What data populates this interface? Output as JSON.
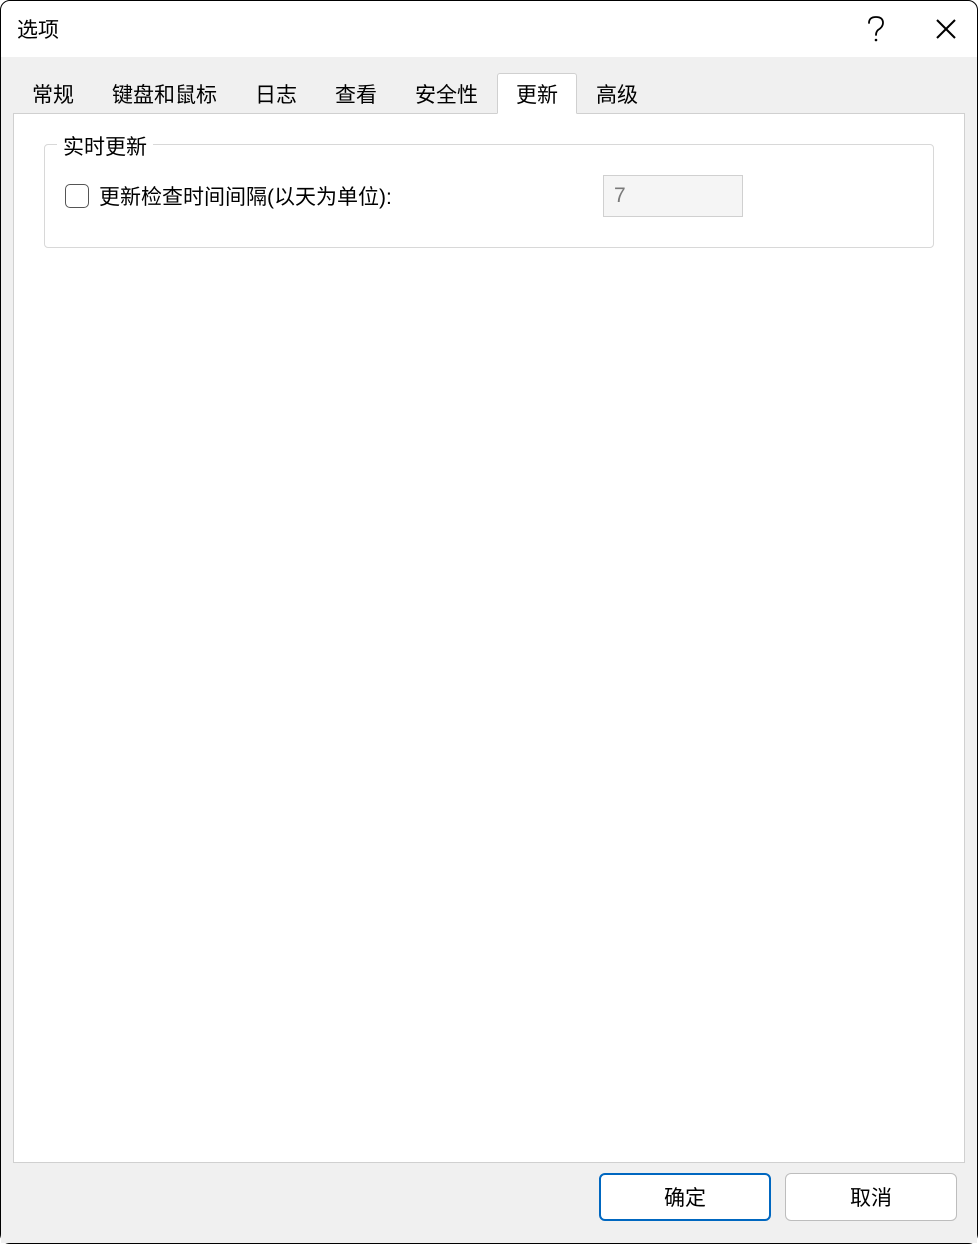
{
  "window": {
    "title": "选项"
  },
  "tabs": [
    {
      "label": "常规"
    },
    {
      "label": "键盘和鼠标"
    },
    {
      "label": "日志"
    },
    {
      "label": "查看"
    },
    {
      "label": "安全性"
    },
    {
      "label": "更新",
      "active": true
    },
    {
      "label": "高级"
    }
  ],
  "update": {
    "group_title": "实时更新",
    "checkbox_label": "更新检查时间间隔(以天为单位):",
    "interval_value": "7"
  },
  "footer": {
    "ok": "确定",
    "cancel": "取消"
  }
}
